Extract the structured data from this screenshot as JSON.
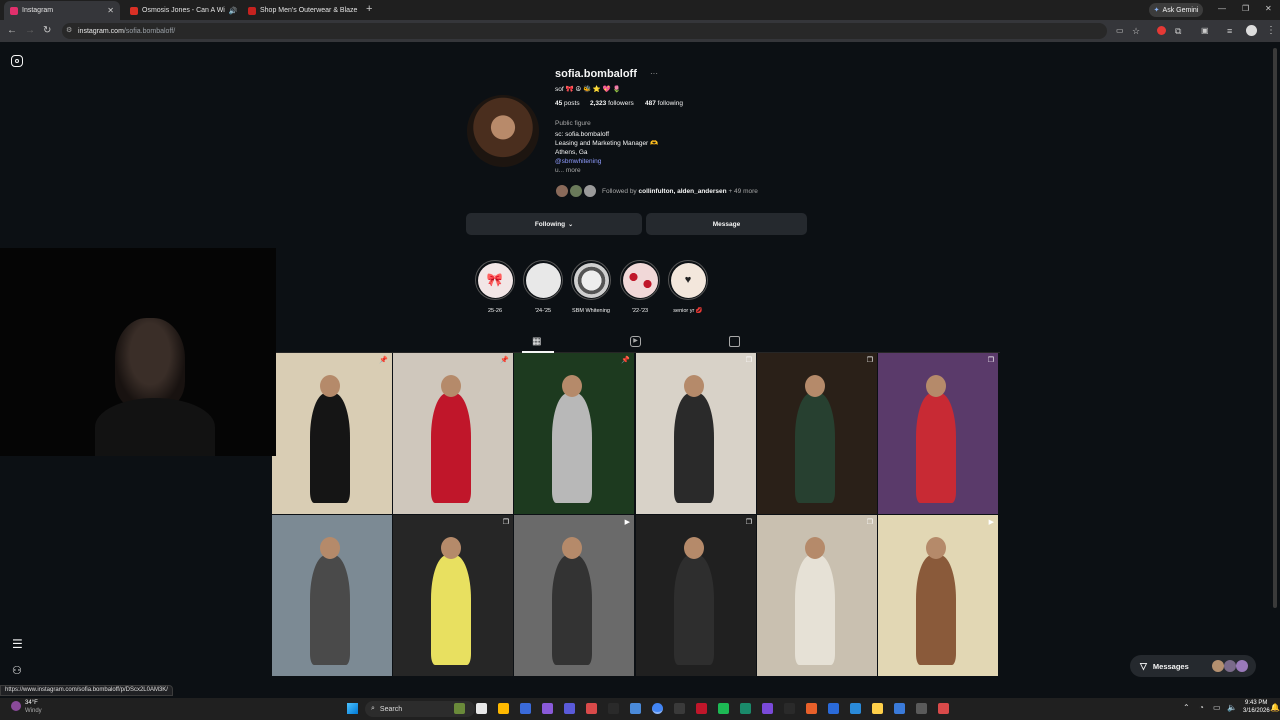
{
  "browser": {
    "tabs": [
      {
        "title": "Instagram",
        "color": "#e1306c",
        "active": true
      },
      {
        "title": "Osmosis Jones - Can A Wi",
        "color": "#d93025",
        "active": false
      },
      {
        "title": "Shop Men's Outerwear & Blaze",
        "color": "#c5221f",
        "active": false
      }
    ],
    "new_tab": "+",
    "ask_gemini": "Ask Gemini",
    "url_host": "instagram.com",
    "url_path": "/sofia.bombaloff/",
    "status_url": "https://www.instagram.com/sofia.bombaloff/p/DScx2L0AM3K/"
  },
  "profile": {
    "username": "sofia.bombaloff",
    "more_dots": "···",
    "tagline": "sof 🎀 ☮ 🐝 ⭐ 💖 🌷",
    "posts_count": "45",
    "posts_label": "posts",
    "followers_count": "2,323",
    "followers_label": "followers",
    "following_count": "487",
    "following_label": "following",
    "category": "Public figure",
    "bio_lines": [
      "sc: sofia.bombaloff",
      "Leasing and Marketing Manager 🫶",
      "Athens, Ga"
    ],
    "link": "@sbmwhitening",
    "more_prefix": "u...",
    "more": "more",
    "followed_by_prefix": "Followed by",
    "followed_by_names": "collinfulton, alden_andersen",
    "followed_by_more": "+ 49 more",
    "following_button": "Following",
    "message_button": "Message"
  },
  "highlights": [
    {
      "label": "25-26",
      "color": "#f2e6e6"
    },
    {
      "label": "'24-'25",
      "color": "#e8e8e8"
    },
    {
      "label": "SBM Whitening",
      "color": "#cfcfcf"
    },
    {
      "label": "'22-'23",
      "color": "#f1d8d8"
    },
    {
      "label": "senior yr 💋",
      "color": "#f3e7dc"
    }
  ],
  "posts": [
    {
      "bg": "#d9cdb4",
      "fig": "#151515",
      "badge": "pin"
    },
    {
      "bg": "#cfc7bc",
      "fig": "#c0162a",
      "badge": "pin"
    },
    {
      "bg": "#1d3a1f",
      "fig": "#b8b8b8",
      "badge": "pin"
    },
    {
      "bg": "#d8d2c8",
      "fig": "#2a2a2a",
      "badge": "multi"
    },
    {
      "bg": "#2a2018",
      "fig": "#274030",
      "badge": "multi"
    },
    {
      "bg": "#5a3a6a",
      "fig": "#c82a34",
      "badge": "multi"
    },
    {
      "bg": "#7c8a94",
      "fig": "#4a4a4a",
      "badge": ""
    },
    {
      "bg": "#262626",
      "fig": "#e8e060",
      "badge": "multi"
    },
    {
      "bg": "#6a6a6a",
      "fig": "#333333",
      "badge": "reel"
    },
    {
      "bg": "#202020",
      "fig": "#2e2e2e",
      "badge": "multi"
    },
    {
      "bg": "#c9c0b0",
      "fig": "#e6e1d6",
      "badge": "multi"
    },
    {
      "bg": "#e2d7b4",
      "fig": "#8a5a3a",
      "badge": "reel"
    }
  ],
  "messages": {
    "label": "Messages"
  },
  "taskbar": {
    "weather_temp": "34°F",
    "weather_desc": "Windy",
    "search": "Search",
    "time": "9:43 PM",
    "date": "3/16/2026"
  }
}
